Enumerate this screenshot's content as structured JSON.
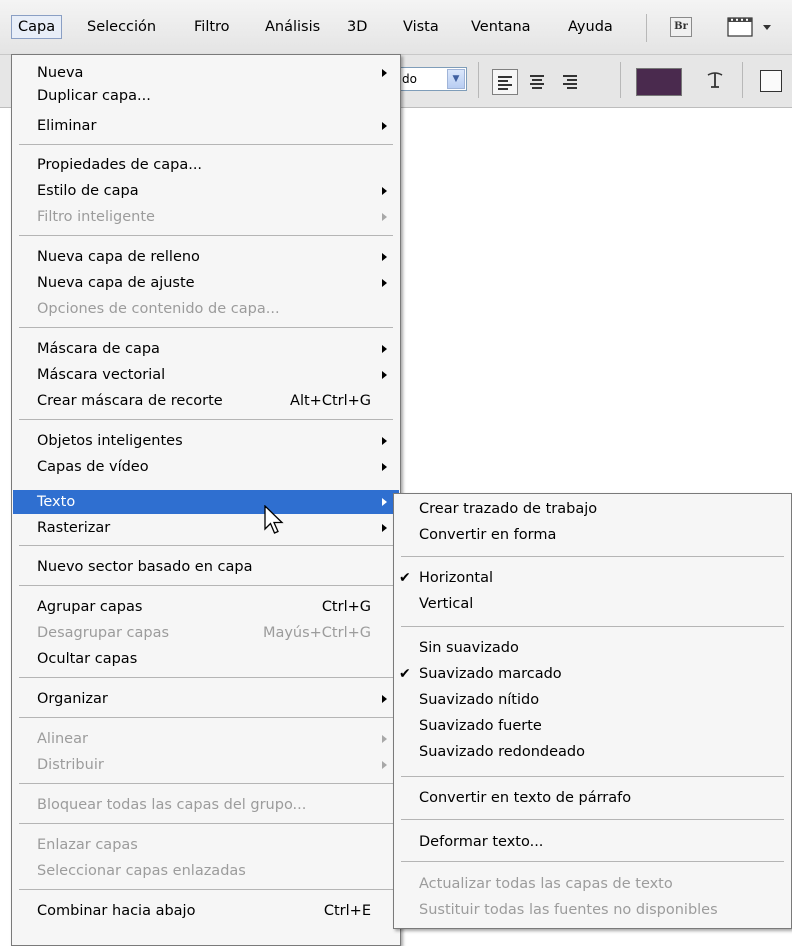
{
  "menubar": {
    "items": [
      "Capa",
      "Selección",
      "Filtro",
      "Análisis",
      "3D",
      "Vista",
      "Ventana",
      "Ayuda"
    ],
    "bridge_button": "Br"
  },
  "options_bar": {
    "antialias_select_value": "cado",
    "text_color": "#4a2a4e"
  },
  "layer_menu": {
    "items": [
      {
        "label": "Nueva",
        "submenu": true
      },
      {
        "label": "Duplicar capa..."
      },
      {
        "label": "Eliminar",
        "submenu": true
      },
      {
        "label": "Propiedades de capa..."
      },
      {
        "label": "Estilo de capa",
        "submenu": true
      },
      {
        "label": "Filtro inteligente",
        "submenu": true,
        "disabled": true
      },
      {
        "label": "Nueva capa de relleno",
        "submenu": true
      },
      {
        "label": "Nueva capa de ajuste",
        "submenu": true
      },
      {
        "label": "Opciones de contenido de capa...",
        "disabled": true
      },
      {
        "label": "Máscara de capa",
        "submenu": true
      },
      {
        "label": "Máscara vectorial",
        "submenu": true
      },
      {
        "label": "Crear máscara de recorte",
        "shortcut": "Alt+Ctrl+G"
      },
      {
        "label": "Objetos inteligentes",
        "submenu": true
      },
      {
        "label": "Capas de vídeo",
        "submenu": true
      },
      {
        "label": "Texto",
        "submenu": true,
        "highlighted": true
      },
      {
        "label": "Rasterizar",
        "submenu": true
      },
      {
        "label": "Nuevo sector basado en capa"
      },
      {
        "label": "Agrupar capas",
        "shortcut": "Ctrl+G"
      },
      {
        "label": "Desagrupar capas",
        "shortcut": "Mayús+Ctrl+G",
        "disabled": true
      },
      {
        "label": "Ocultar capas"
      },
      {
        "label": "Organizar",
        "submenu": true
      },
      {
        "label": "Alinear",
        "submenu": true,
        "disabled": true
      },
      {
        "label": "Distribuir",
        "submenu": true,
        "disabled": true
      },
      {
        "label": "Bloquear todas las capas del grupo...",
        "disabled": true
      },
      {
        "label": "Enlazar capas",
        "disabled": true
      },
      {
        "label": "Seleccionar capas enlazadas",
        "disabled": true
      },
      {
        "label": "Combinar hacia abajo",
        "shortcut": "Ctrl+E"
      }
    ]
  },
  "text_submenu": {
    "items": [
      {
        "label": "Crear trazado de trabajo"
      },
      {
        "label": "Convertir en forma"
      },
      {
        "label": "Horizontal",
        "checked": true
      },
      {
        "label": "Vertical"
      },
      {
        "label": "Sin suavizado"
      },
      {
        "label": "Suavizado marcado",
        "checked": true
      },
      {
        "label": "Suavizado nítido"
      },
      {
        "label": "Suavizado fuerte"
      },
      {
        "label": "Suavizado redondeado"
      },
      {
        "label": "Convertir en texto de párrafo"
      },
      {
        "label": "Deformar texto..."
      },
      {
        "label": "Actualizar todas las capas de texto",
        "disabled": true
      },
      {
        "label": "Sustituir todas las fuentes no disponibles",
        "disabled": true
      }
    ]
  }
}
